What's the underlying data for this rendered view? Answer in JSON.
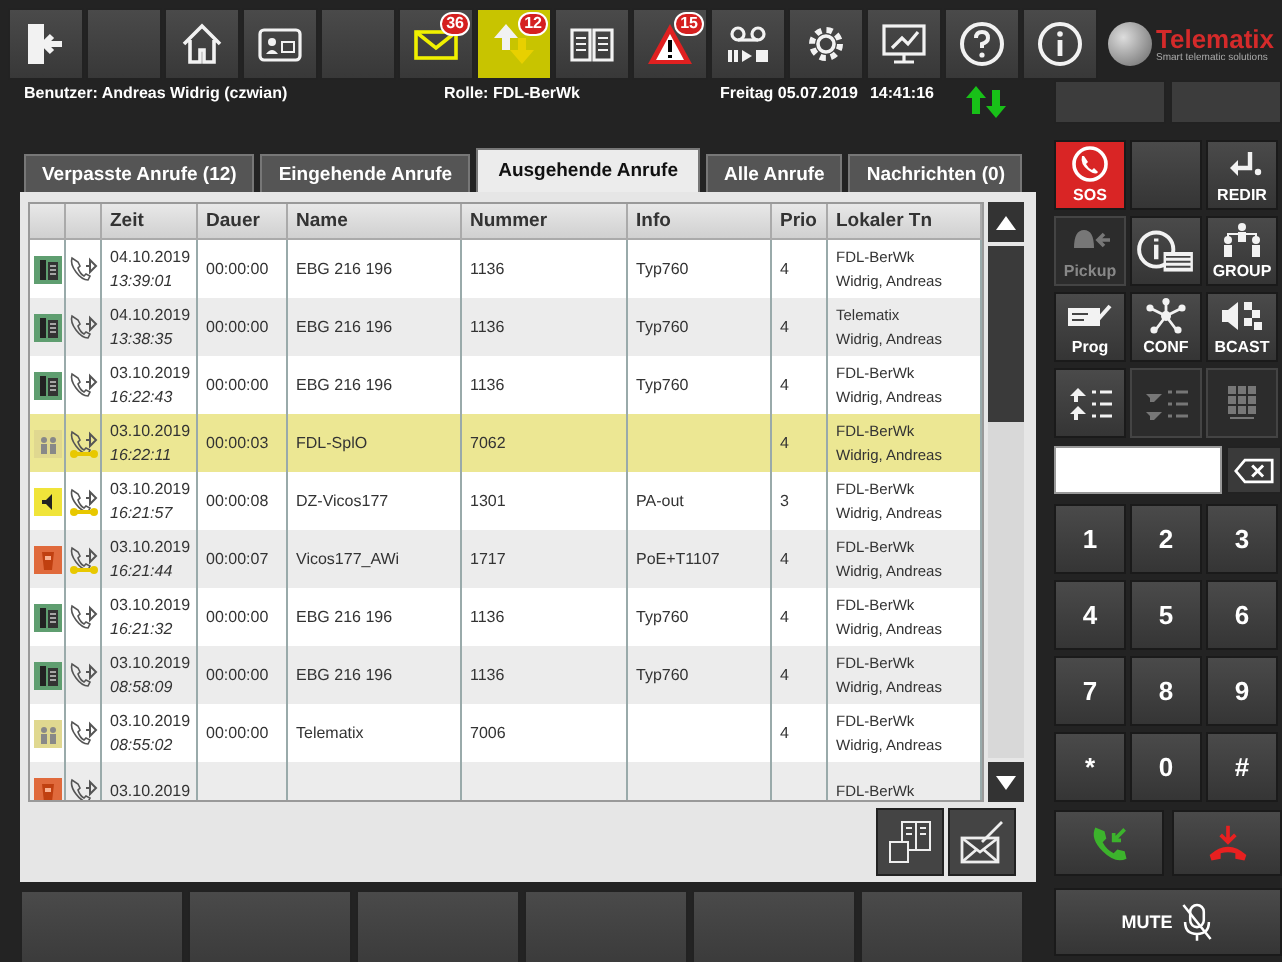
{
  "toolbar": [
    {
      "kind": "exit",
      "highlighted": false
    },
    {
      "kind": "blank",
      "highlighted": false
    },
    {
      "kind": "home",
      "highlighted": false
    },
    {
      "kind": "contacts",
      "highlighted": false
    },
    {
      "kind": "blank",
      "highlighted": false
    },
    {
      "kind": "mail",
      "badge": "36",
      "highlighted": false
    },
    {
      "kind": "transfer",
      "badge": "12",
      "highlighted": true
    },
    {
      "kind": "book",
      "highlighted": false
    },
    {
      "kind": "warning",
      "badge": "15",
      "highlighted": false
    },
    {
      "kind": "voicemail",
      "highlighted": false
    },
    {
      "kind": "settings",
      "highlighted": false
    },
    {
      "kind": "monitor",
      "highlighted": false
    },
    {
      "kind": "help",
      "highlighted": false
    },
    {
      "kind": "info",
      "highlighted": false
    }
  ],
  "logo": {
    "name": "Telematix",
    "tagline": "Smart telematic solutions"
  },
  "status_bar": {
    "user": "Benutzer: Andreas Widrig (czwian)",
    "role": "Rolle: FDL-BerWk",
    "date": "Freitag 05.07.2019",
    "time": "14:41:16"
  },
  "tabs": [
    {
      "label": "Verpasste Anrufe (12)",
      "selected": false
    },
    {
      "label": "Eingehende Anrufe",
      "selected": false
    },
    {
      "label": "Ausgehende Anrufe",
      "selected": true
    },
    {
      "label": "Alle Anrufe",
      "selected": false
    },
    {
      "label": "Nachrichten (0)",
      "selected": false
    }
  ],
  "table": {
    "columns": [
      "Zeit",
      "Dauer",
      "Name",
      "Nummer",
      "Info",
      "Prio",
      "Lokaler Tn"
    ],
    "rows": [
      {
        "kind": "phone",
        "linked": false,
        "selected": false,
        "date": "04.10.2019",
        "time": "13:39:01",
        "duration": "00:00:00",
        "name": "EBG 216 196",
        "number": "1136",
        "info": "Typ760",
        "prio": "4",
        "local_station": "FDL-BerWk",
        "local_user": "Widrig, Andreas"
      },
      {
        "kind": "phone",
        "linked": false,
        "selected": false,
        "date": "04.10.2019",
        "time": "13:38:35",
        "duration": "00:00:00",
        "name": "EBG 216 196",
        "number": "1136",
        "info": "Typ760",
        "prio": "4",
        "local_station": "Telematix",
        "local_user": "Widrig, Andreas"
      },
      {
        "kind": "phone",
        "linked": false,
        "selected": false,
        "date": "03.10.2019",
        "time": "16:22:43",
        "duration": "00:00:00",
        "name": "EBG 216 196",
        "number": "1136",
        "info": "Typ760",
        "prio": "4",
        "local_station": "FDL-BerWk",
        "local_user": "Widrig, Andreas"
      },
      {
        "kind": "group",
        "linked": true,
        "selected": true,
        "date": "03.10.2019",
        "time": "16:22:11",
        "duration": "00:00:03",
        "name": "FDL-SplO",
        "number": "7062",
        "prio": "4",
        "local_station": "FDL-BerWk",
        "local_user": "Widrig, Andreas"
      },
      {
        "kind": "speaker",
        "linked": true,
        "selected": false,
        "date": "03.10.2019",
        "time": "16:21:57",
        "duration": "00:00:08",
        "name": "DZ-Vicos177",
        "number": "1301",
        "info": "PA-out",
        "prio": "3",
        "local_station": "FDL-BerWk",
        "local_user": "Widrig, Andreas"
      },
      {
        "kind": "handset",
        "linked": true,
        "selected": false,
        "date": "03.10.2019",
        "time": "16:21:44",
        "duration": "00:00:07",
        "name": "Vicos177_AWi",
        "number": "1717",
        "info": "PoE+T1107",
        "prio": "4",
        "local_station": "FDL-BerWk",
        "local_user": "Widrig, Andreas"
      },
      {
        "kind": "phone",
        "linked": false,
        "selected": false,
        "date": "03.10.2019",
        "time": "16:21:32",
        "duration": "00:00:00",
        "name": "EBG 216 196",
        "number": "1136",
        "info": "Typ760",
        "prio": "4",
        "local_station": "FDL-BerWk",
        "local_user": "Widrig, Andreas"
      },
      {
        "kind": "phone",
        "linked": false,
        "selected": false,
        "date": "03.10.2019",
        "time": "08:58:09",
        "duration": "00:00:00",
        "name": "EBG 216 196",
        "number": "1136",
        "info": "Typ760",
        "prio": "4",
        "local_station": "FDL-BerWk",
        "local_user": "Widrig, Andreas"
      },
      {
        "kind": "group",
        "linked": false,
        "selected": false,
        "date": "03.10.2019",
        "time": "08:55:02",
        "duration": "00:00:00",
        "name": "Telematix",
        "number": "7006",
        "prio": "4",
        "local_station": "FDL-BerWk",
        "local_user": "Widrig, Andreas"
      },
      {
        "kind": "handset",
        "linked": false,
        "selected": false,
        "date": "03.10.2019",
        "local_station": "FDL-BerWk"
      }
    ]
  },
  "function_keys": [
    {
      "kind": "sos",
      "label": "SOS",
      "disabled": false
    },
    {
      "kind": "blank",
      "disabled": false
    },
    {
      "kind": "redirect",
      "label": "REDIR",
      "disabled": false
    },
    {
      "kind": "pickup",
      "label": "Pickup",
      "disabled": true
    },
    {
      "kind": "info-card",
      "disabled": false
    },
    {
      "kind": "group",
      "label": "GROUP",
      "disabled": false
    },
    {
      "kind": "program",
      "label": "Prog",
      "disabled": false
    },
    {
      "kind": "conference",
      "label": "CONF",
      "disabled": false
    },
    {
      "kind": "broadcast",
      "label": "BCAST",
      "disabled": false
    },
    {
      "kind": "list-up",
      "disabled": false
    },
    {
      "kind": "list-down",
      "disabled": true
    },
    {
      "kind": "keypad",
      "disabled": true
    }
  ],
  "keypad": [
    "1",
    "2",
    "3",
    "4",
    "5",
    "6",
    "7",
    "8",
    "9",
    "*",
    "0",
    "#"
  ],
  "mute": {
    "label": "MUTE"
  }
}
